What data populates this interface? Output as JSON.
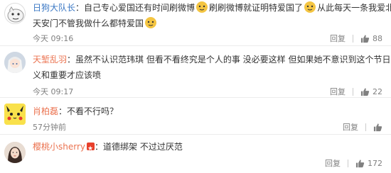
{
  "comments": [
    {
      "username": "日狗大队长",
      "separator": "：",
      "text_parts": [
        "自己专心爱国还有时间刷微博",
        "刷刷微博就证明特爱国了",
        "从此每天一条我爱北京",
        "天安门不管我做什么都特爱国"
      ],
      "time": "今天 09:16",
      "reply_label": "回复",
      "like_count": "88",
      "like_icon": "thumbs-up-icon",
      "avatar": "cartoon-avatar"
    },
    {
      "username": "天堑乱羽",
      "separator": "：",
      "text_line1": "虽然不认识范玮琪 但看不看终究是个人的事 没必要这样 但如果她不意识到这个节日的意",
      "text_line2": "义和重要才应该喷",
      "time": "今天 09:17",
      "reply_label": "回复",
      "like_count": "22",
      "like_icon": "thumbs-up-icon",
      "avatar": "anime-girl-avatar"
    },
    {
      "username": "肖柏磊",
      "separator": "：",
      "text": "不看不行吗？",
      "time": "57分钟前",
      "reply_label": "回复",
      "like_icon": "thumbs-up-icon",
      "avatar": "pikachu-avatar"
    },
    {
      "username": "樱桃小sherry",
      "separator": "：",
      "text": "道德绑架 不过过厌范",
      "time": "",
      "reply_label": "回复",
      "like_count": "172",
      "like_icon": "thumbs-up-icon",
      "avatar": "photo-avatar"
    }
  ],
  "colors": {
    "username_orange": "#eb7350",
    "username_blue": "#3b78c4",
    "meta_gray": "#808080",
    "divider": "#ececec"
  }
}
